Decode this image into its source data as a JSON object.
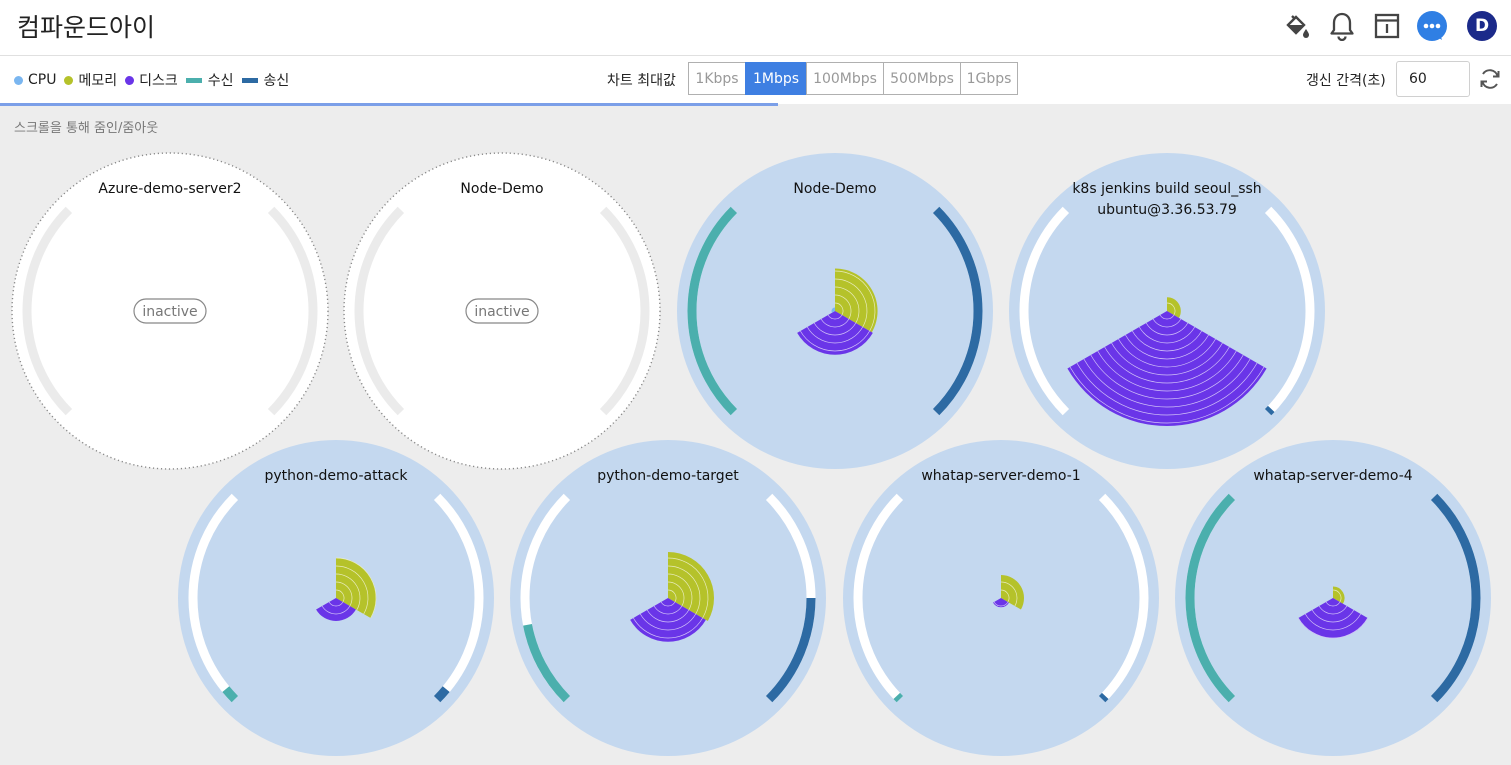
{
  "app": {
    "title": "컴파운드아이"
  },
  "header_icons": [
    {
      "name": "paint-bucket-icon",
      "type": "bucket"
    },
    {
      "name": "bell-icon",
      "type": "bell"
    },
    {
      "name": "info-panel-icon",
      "type": "panel"
    },
    {
      "name": "chat-icon",
      "type": "chat"
    },
    {
      "name": "user-avatar",
      "type": "avatar",
      "label": "D"
    }
  ],
  "legend": [
    {
      "label": "CPU",
      "color": "#7ab6f0",
      "shape": "dot"
    },
    {
      "label": "메모리",
      "color": "#b5c22a",
      "shape": "dot"
    },
    {
      "label": "디스크",
      "color": "#6a35e8",
      "shape": "dot"
    },
    {
      "label": "수신",
      "color": "#4bafad",
      "shape": "bar"
    },
    {
      "label": "송신",
      "color": "#2d6aa3",
      "shape": "bar"
    }
  ],
  "chart_max": {
    "label": "차트 최대값",
    "options": [
      "1Kbps",
      "1Mbps",
      "100Mbps",
      "500Mbps",
      "1Gbps"
    ],
    "selected": "1Mbps"
  },
  "refresh": {
    "label": "갱신 간격(초)",
    "value": "60"
  },
  "hint": "스크롤을 통해 줌인/줌아웃",
  "colors": {
    "cpu": "#7ab6f0",
    "memory": "#b5c22a",
    "disk": "#6a35e8",
    "rx": "#4bafad",
    "tx": "#2d6aa3",
    "active_bg": "#c4d8ef",
    "inactive_bg": "#ffffff",
    "track": "#ffffff",
    "inactive_track": "#ebebeb"
  },
  "progress": 0.515,
  "servers": [
    {
      "name": "Azure-demo-server2",
      "status": "inactive"
    },
    {
      "name": "Node-Demo",
      "status": "inactive"
    },
    {
      "name": "Node-Demo",
      "status": "active",
      "cpu": 0.03,
      "memory": 0.37,
      "disk": 0.38,
      "rx": 1.0,
      "tx": 1.0
    },
    {
      "name": "k8s jenkins build seoul_ssh\nubuntu@3.36.53.79",
      "status": "active",
      "cpu": 0.0,
      "memory": 0.12,
      "disk": 1.0,
      "rx": 0.0,
      "tx": 0.02
    },
    {
      "name": "python-demo-attack",
      "status": "active",
      "cpu": 0.0,
      "memory": 0.35,
      "disk": 0.2,
      "rx": 0.06,
      "tx": 0.06
    },
    {
      "name": "python-demo-target",
      "status": "active",
      "cpu": 0.0,
      "memory": 0.4,
      "disk": 0.38,
      "rx": 0.38,
      "tx": 0.5
    },
    {
      "name": "whatap-server-demo-1",
      "status": "active",
      "cpu": 0.0,
      "memory": 0.2,
      "disk": 0.08,
      "rx": 0.02,
      "tx": 0.02
    },
    {
      "name": "whatap-server-demo-4",
      "status": "active",
      "cpu": 0.0,
      "memory": 0.1,
      "disk": 0.35,
      "rx": 1.0,
      "tx": 1.0
    }
  ]
}
